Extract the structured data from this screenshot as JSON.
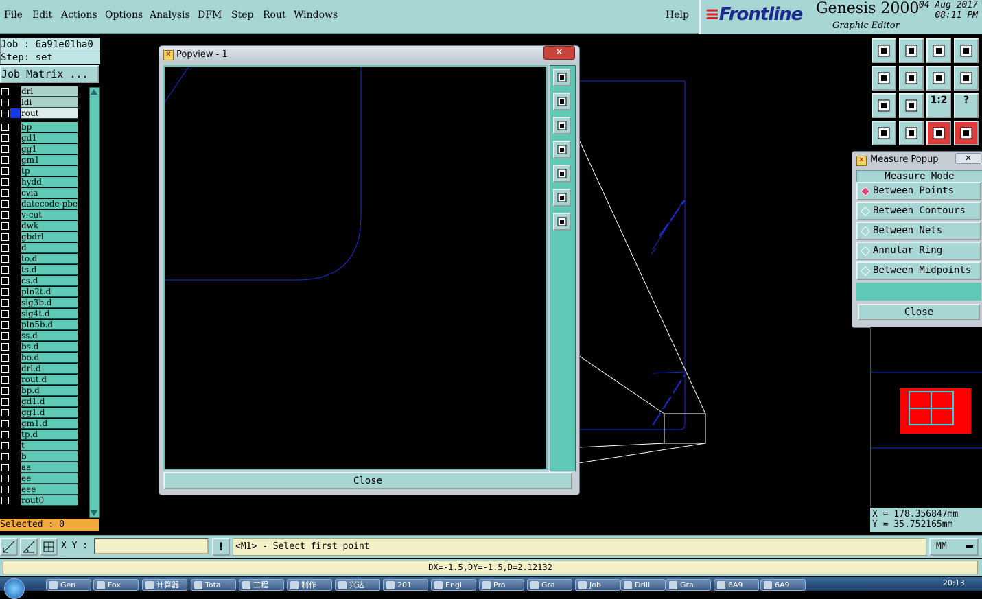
{
  "menu": {
    "items": [
      "File",
      "Edit",
      "Actions",
      "Options",
      "Analysis",
      "DFM",
      "Step",
      "Rout",
      "Windows"
    ],
    "help": "Help"
  },
  "brand": {
    "logo": "Frontline",
    "title": "Genesis 2000",
    "subtitle": "Graphic Editor",
    "date": "04 Aug 2017",
    "time": "08:11 PM"
  },
  "left": {
    "job": "Job : 6a91e01ha0",
    "step": "Step: set",
    "job_matrix": "Job Matrix ...",
    "layers": [
      "drl",
      "ldi",
      "rout",
      "bp",
      "gd1",
      "gg1",
      "gm1",
      "tp",
      "hydd",
      "cvia",
      "datecode-pbe",
      "v-cut",
      "dwk",
      "gbdrl",
      "d",
      "to.d",
      "ts.d",
      "cs.d",
      "pln2t.d",
      "sig3b.d",
      "sig4t.d",
      "pln5b.d",
      "ss.d",
      "bs.d",
      "bo.d",
      "drl.d",
      "rout.d",
      "bp.d",
      "gd1.d",
      "gg1.d",
      "gm1.d",
      "tp.d",
      "t",
      "b",
      "aa",
      "ee",
      "eee",
      "rout0"
    ],
    "active_layer": "rout",
    "selected": "Selected : 0"
  },
  "popview": {
    "title": "Popview - 1",
    "close": "Close",
    "tools": [
      "zoom-fit-icon",
      "pan-up-icon",
      "pan-down-icon",
      "pan-left-icon",
      "pan-right-icon",
      "zoom-home-icon",
      "zoom-center-icon"
    ]
  },
  "right_tools": {
    "icons": [
      "pan-up-icon",
      "pan-down-icon",
      "home-icon",
      "zoom-window-icon",
      "pan-left-icon",
      "pan-right-icon",
      "zoom-back-icon",
      "redraw-icon",
      "zoom-out-icon",
      "zoom-in-icon",
      "scale-icon",
      "help-icon",
      "palette-icon",
      "snap-icon",
      "layers-icon",
      "layers-alt-icon"
    ],
    "scale_label": "1:2",
    "help_label": "?"
  },
  "measure": {
    "title": "Measure Popup",
    "header": "Measure Mode",
    "options": [
      "Between Points",
      "Between Contours",
      "Between Nets",
      "Annular Ring",
      "Between Midpoints"
    ],
    "selected": "Between Points",
    "close": "Close"
  },
  "coords": {
    "x": "X = 178.356847mm",
    "y": "Y = 35.752165mm"
  },
  "cmd": {
    "xy_label": "X Y :",
    "xy_value": "",
    "prompt": "<M1> - Select first point",
    "units": "MM"
  },
  "status": "DX=-1.5,DY=-1.5,D=2.12132",
  "taskbar": {
    "tasks": [
      "Gen",
      "Fox",
      "计算器",
      "Tota",
      "工程",
      "制作",
      "兴达",
      "201",
      "Engi",
      "Pro",
      "Gra",
      "Job",
      "Drill",
      "Gra",
      "6A9",
      "6A9"
    ],
    "clock": "20:13"
  },
  "colors": {
    "panel": "#a7d6d5",
    "layer": "#5fc9b5",
    "contour": "#1a2bd6",
    "active_swatch": "#1a39e6",
    "selected_bar": "#f2a93b",
    "prompt_bg": "#f3f0c8"
  }
}
